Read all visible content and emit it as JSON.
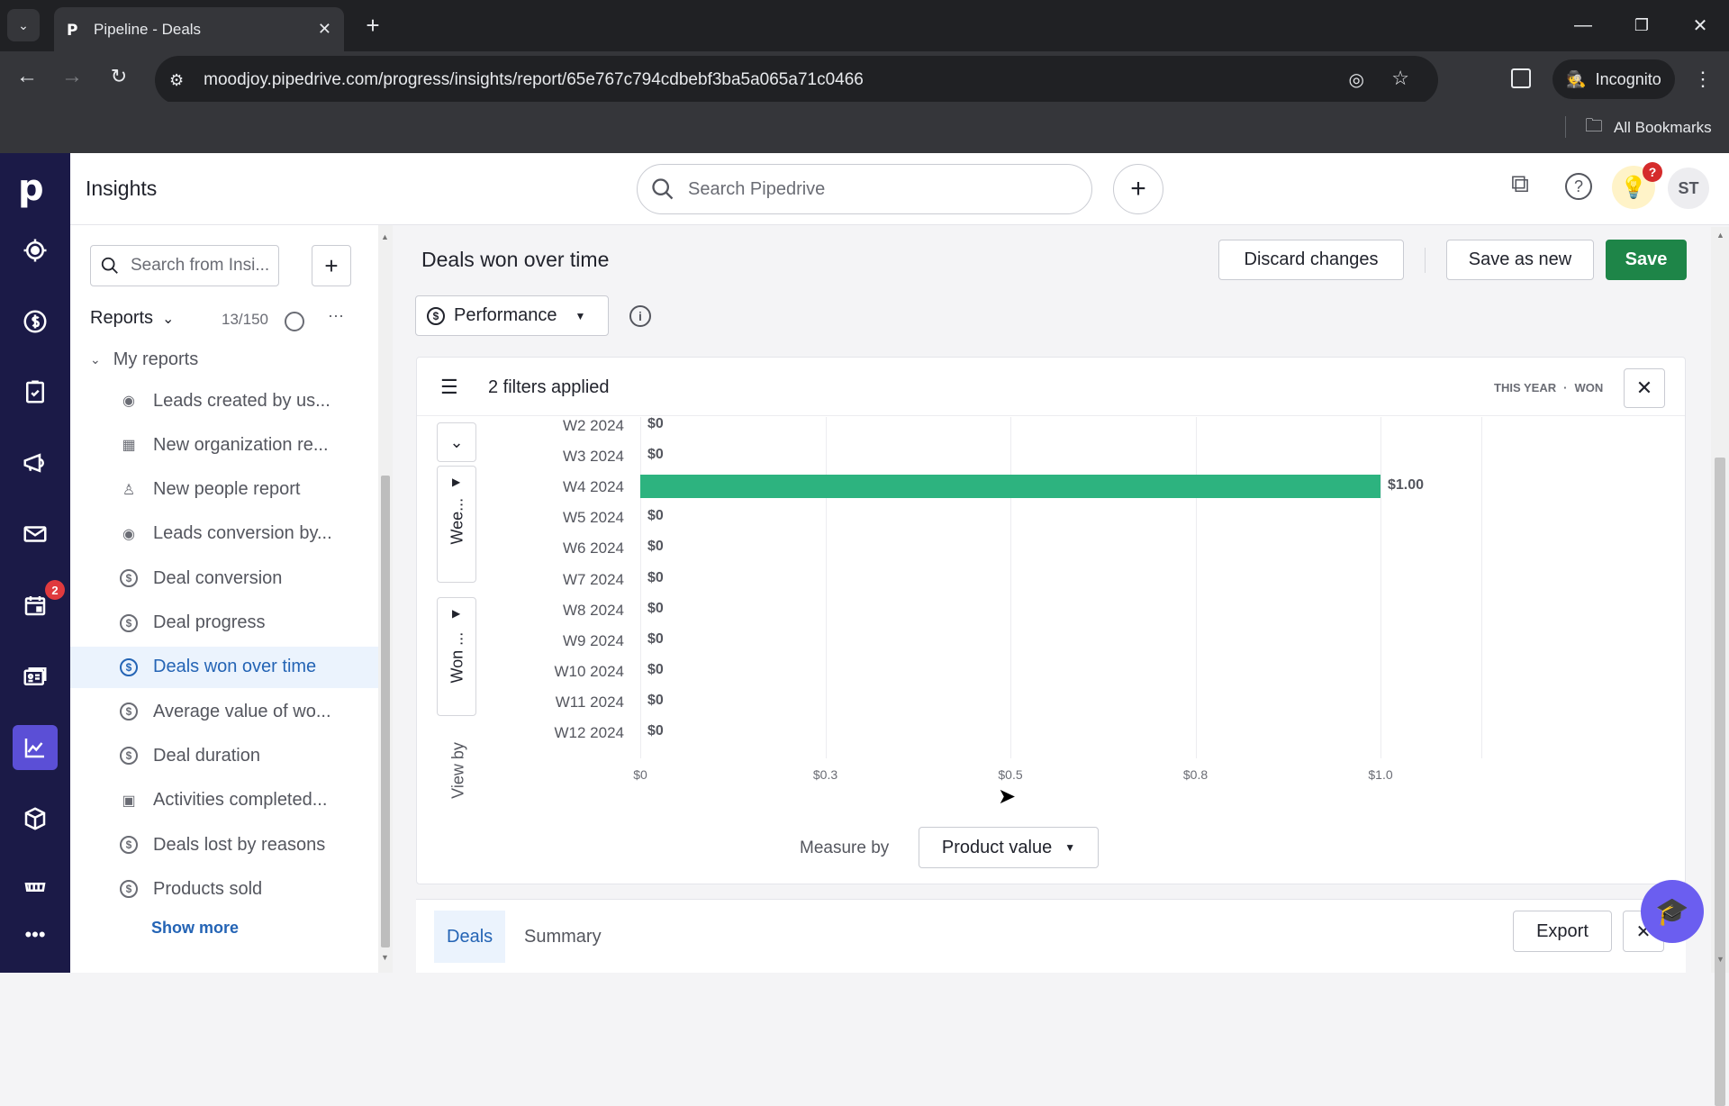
{
  "browser": {
    "tab_title": "Pipeline - Deals",
    "url": "moodjoy.pipedrive.com/progress/insights/report/65e767c794cdbebf3ba5a065a71c0466",
    "incognito_label": "Incognito",
    "bookmarks_label": "All Bookmarks"
  },
  "app": {
    "section_title": "Insights",
    "search_placeholder": "Search Pipedrive",
    "avatar_initials": "ST",
    "nav_badge_count": "2",
    "nav_items": [
      "leads",
      "deals",
      "activities-tasks",
      "campaigns",
      "mail",
      "calendar",
      "contacts",
      "insights",
      "products",
      "marketplace",
      "more"
    ]
  },
  "sidebar": {
    "search_placeholder": "Search from Insi...",
    "reports_label": "Reports",
    "reports_count": "13/150",
    "group_label": "My reports",
    "items": [
      {
        "label": "Leads created by us...",
        "icon": "target"
      },
      {
        "label": "New organization re...",
        "icon": "building"
      },
      {
        "label": "New people report",
        "icon": "person"
      },
      {
        "label": "Leads conversion by...",
        "icon": "target"
      },
      {
        "label": "Deal conversion",
        "icon": "dollar"
      },
      {
        "label": "Deal progress",
        "icon": "dollar"
      },
      {
        "label": "Deals won over time",
        "icon": "dollar",
        "active": true
      },
      {
        "label": "Average value of wo...",
        "icon": "dollar"
      },
      {
        "label": "Deal duration",
        "icon": "dollar"
      },
      {
        "label": "Activities completed...",
        "icon": "calendar"
      },
      {
        "label": "Deals lost by reasons",
        "icon": "dollar"
      },
      {
        "label": "Products sold",
        "icon": "dollar"
      }
    ],
    "show_more": "Show more"
  },
  "report": {
    "title": "Deals won over time",
    "discard_label": "Discard changes",
    "save_as_new_label": "Save as new",
    "save_label": "Save",
    "type_label": "Performance",
    "filters_label": "2 filters applied",
    "filter_tags": [
      "THIS YEAR",
      "WON"
    ],
    "view_by_label": "View by",
    "group_week_label": "Wee...",
    "group_won_label": "Won ...",
    "measure_by_label": "Measure by",
    "measure_value": "Product value",
    "bottom_tabs": [
      "Deals",
      "Summary"
    ],
    "export_label": "Export"
  },
  "colors": {
    "accent_green": "#2db37f",
    "save_green": "#1e8548",
    "nav_bg": "#1b1a47",
    "nav_active": "#5b4fd6",
    "link_blue": "#2464b5"
  },
  "chart_data": {
    "type": "bar",
    "orientation": "horizontal",
    "title": "Deals won over time",
    "xlabel": "Product value",
    "ylabel": "Week",
    "categories": [
      "W2 2024",
      "W3 2024",
      "W4 2024",
      "W5 2024",
      "W6 2024",
      "W7 2024",
      "W8 2024",
      "W9 2024",
      "W10 2024",
      "W11 2024",
      "W12 2024"
    ],
    "values": [
      0,
      0,
      1,
      0,
      0,
      0,
      0,
      0,
      0,
      0,
      0
    ],
    "value_labels": [
      "$0",
      "$0",
      "$1.00",
      "$0",
      "$0",
      "$0",
      "$0",
      "$0",
      "$0",
      "$0",
      "$0"
    ],
    "x_ticks": [
      "$0",
      "$0.3",
      "$0.5",
      "$0.8",
      "$1.0"
    ],
    "x_tick_values": [
      0,
      0.25,
      0.5,
      0.75,
      1.0
    ],
    "xlim": [
      0,
      1.0
    ],
    "grid": true
  }
}
